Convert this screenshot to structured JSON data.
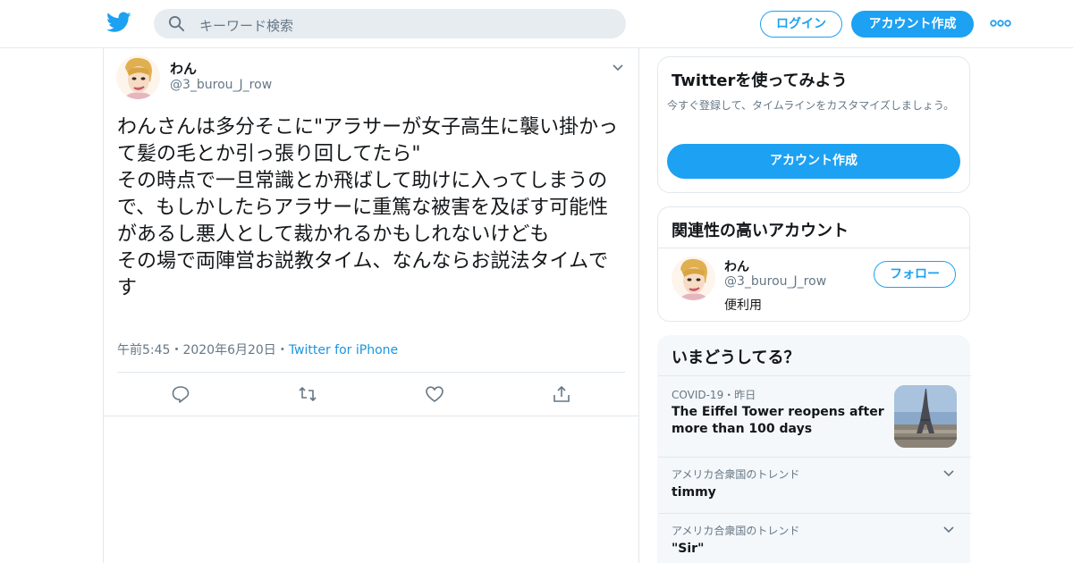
{
  "header": {
    "search_placeholder": "キーワード検索",
    "login_label": "ログイン",
    "signup_label": "アカウント作成",
    "brand_color": "#1da1f2",
    "icons": [
      "twitter-bird-icon",
      "search-icon",
      "more-dots-icon"
    ]
  },
  "tweet": {
    "name": "わん",
    "handle": "@3_burou_J_row",
    "text": "わんさんは多分そこに\"アラサーが女子高生に襲い掛かって髪の毛とか引っ張り回してたら\"\nその時点で一旦常識とか飛ばして助けに入ってしまうので、もしかしたらアラサーに重篤な被害を及ぼす可能性があるし悪人として裁かれるかもしれないけども\nその場で両陣営お説教タイム、なんならお説法タイムです",
    "time": "午前5:45",
    "date": "2020年6月20日",
    "source": "Twitter for iPhone",
    "separator": "・",
    "actions": [
      "reply-icon",
      "retweet-icon",
      "like-icon",
      "share-icon"
    ]
  },
  "sidebar": {
    "signup_card": {
      "title": "Twitterを使ってみよう",
      "description": "今すぐ登録して、タイムラインをカスタマイズしましょう。",
      "button": "アカウント作成"
    },
    "related_card": {
      "title": "関連性の高いアカウント",
      "name": "わん",
      "handle": "@3_burou_J_row",
      "bio": "便利用",
      "follow_label": "フォロー"
    },
    "trends_card": {
      "title": "いまどうしてる？",
      "items": [
        {
          "category": "COVID-19",
          "time": "昨日",
          "title": "The Eiffel Tower reopens after more than 100 days"
        },
        {
          "category": "アメリカ合衆国のトレンド",
          "title": "timmy"
        },
        {
          "category": "アメリカ合衆国のトレンド",
          "title": "\"Sir\""
        }
      ]
    }
  }
}
